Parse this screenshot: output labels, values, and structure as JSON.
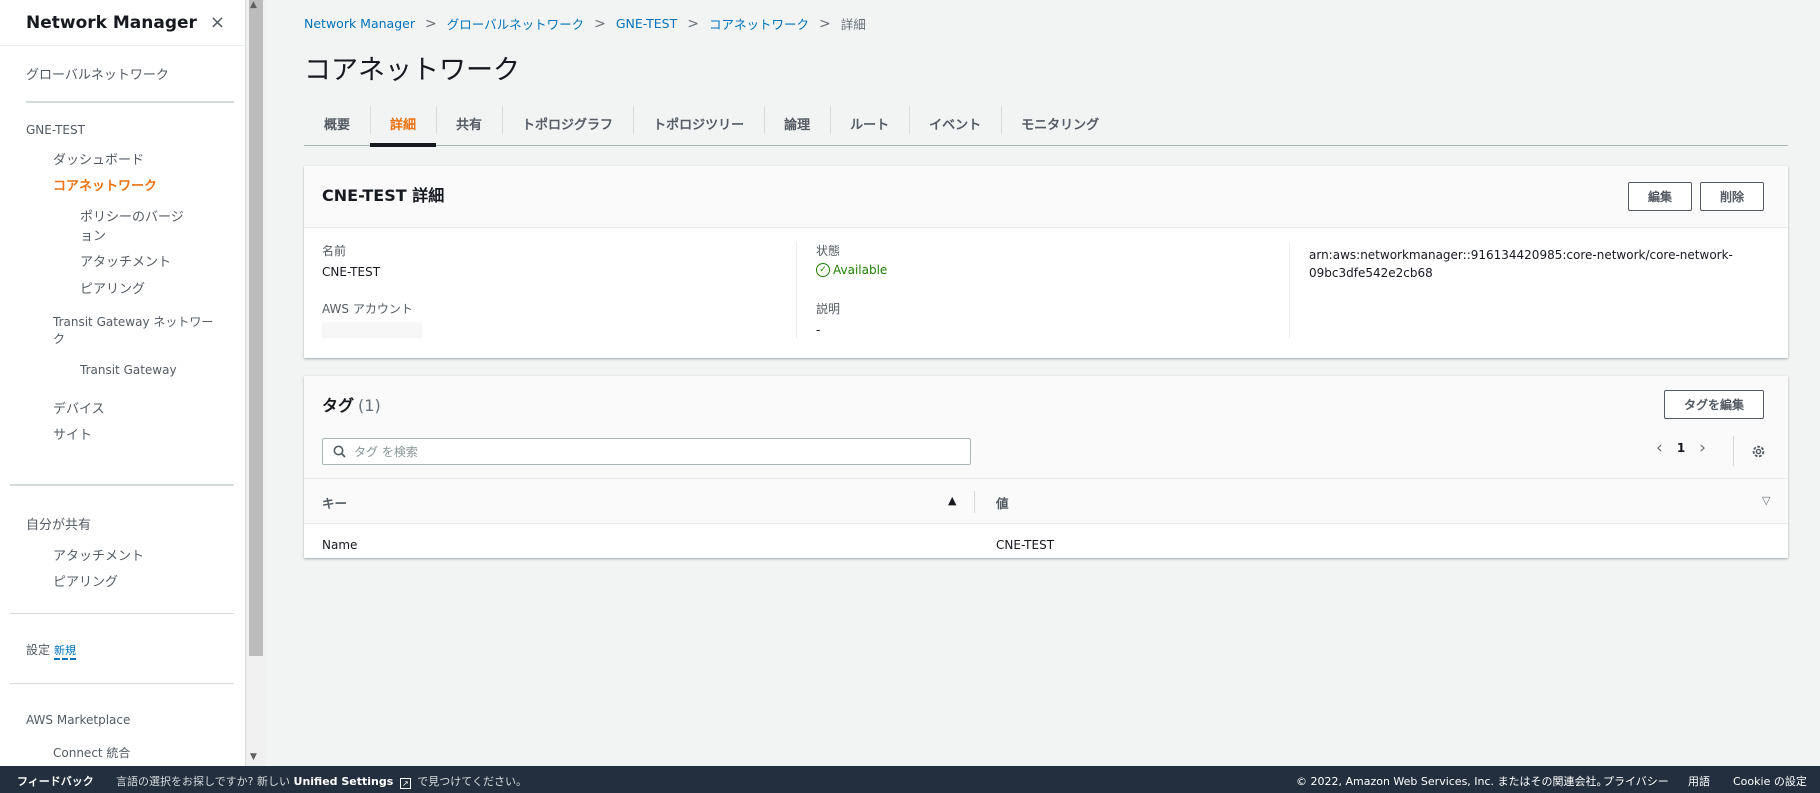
{
  "sidebar": {
    "title": "Network Manager",
    "close_icon": "×",
    "global_networks": "グローバルネットワーク",
    "network_name": "GNE-TEST",
    "dashboard": "ダッシュボード",
    "core_network": "コアネットワーク",
    "policy_versions_l1": "ポリシーのバージ",
    "policy_versions_l2": "ョン",
    "attachments": "アタッチメント",
    "peering": "ピアリング",
    "tgw_network_l1": "Transit Gateway ネットワー",
    "tgw_network_l2": "ク",
    "transit_gateway": "Transit Gateway",
    "devices": "デバイス",
    "sites": "サイト",
    "shared_with_me": "自分が共有",
    "shared_attachments": "アタッチメント",
    "shared_peering": "ピアリング",
    "settings": "設定",
    "settings_badge": "新規",
    "marketplace": "AWS Marketplace",
    "connect_integration": "Connect 統合"
  },
  "breadcrumb": {
    "items": [
      "Network Manager",
      "グローバルネットワーク",
      "GNE-TEST",
      "コアネットワーク"
    ],
    "current": "詳細",
    "separator": ">"
  },
  "page_title": "コアネットワーク",
  "tabs": [
    "概要",
    "詳細",
    "共有",
    "トポロジグラフ",
    "トポロジツリー",
    "論理",
    "ルート",
    "イベント",
    "モニタリング"
  ],
  "active_tab": "詳細",
  "details": {
    "title": "CNE-TEST 詳細",
    "edit_button": "編集",
    "delete_button": "削除",
    "name_label": "名前",
    "name_value": "CNE-TEST",
    "account_label": "AWS アカウント",
    "status_label": "状態",
    "status_value": "Available",
    "description_label": "説明",
    "description_value": "-",
    "arn_line1": "arn:aws:networkmanager::916134420985:core-network/core-network-",
    "arn_line2": "09bc3dfe542e2cb68"
  },
  "tags": {
    "title": "タグ",
    "count": "(1)",
    "edit_button": "タグを編集",
    "search_placeholder": "タグ を検索",
    "page": "1",
    "columns": {
      "key": "キー",
      "value": "値"
    },
    "rows": [
      {
        "key": "Name",
        "value": "CNE-TEST"
      }
    ]
  },
  "footer": {
    "feedback": "フィードバック",
    "lang_prefix": "言語の選択をお探しですか? 新しい",
    "unified_settings": "Unified Settings",
    "lang_suffix": "で見つけてください。",
    "copyright": "© 2022, Amazon Web Services, Inc. またはその関連会社。",
    "privacy": "プライバシー",
    "terms": "用語",
    "cookie": "Cookie の設定"
  },
  "colors": {
    "accent": "#ec7211",
    "link": "#0073bb",
    "status_ok": "#1d8102",
    "footer_bg": "#232f3e"
  }
}
